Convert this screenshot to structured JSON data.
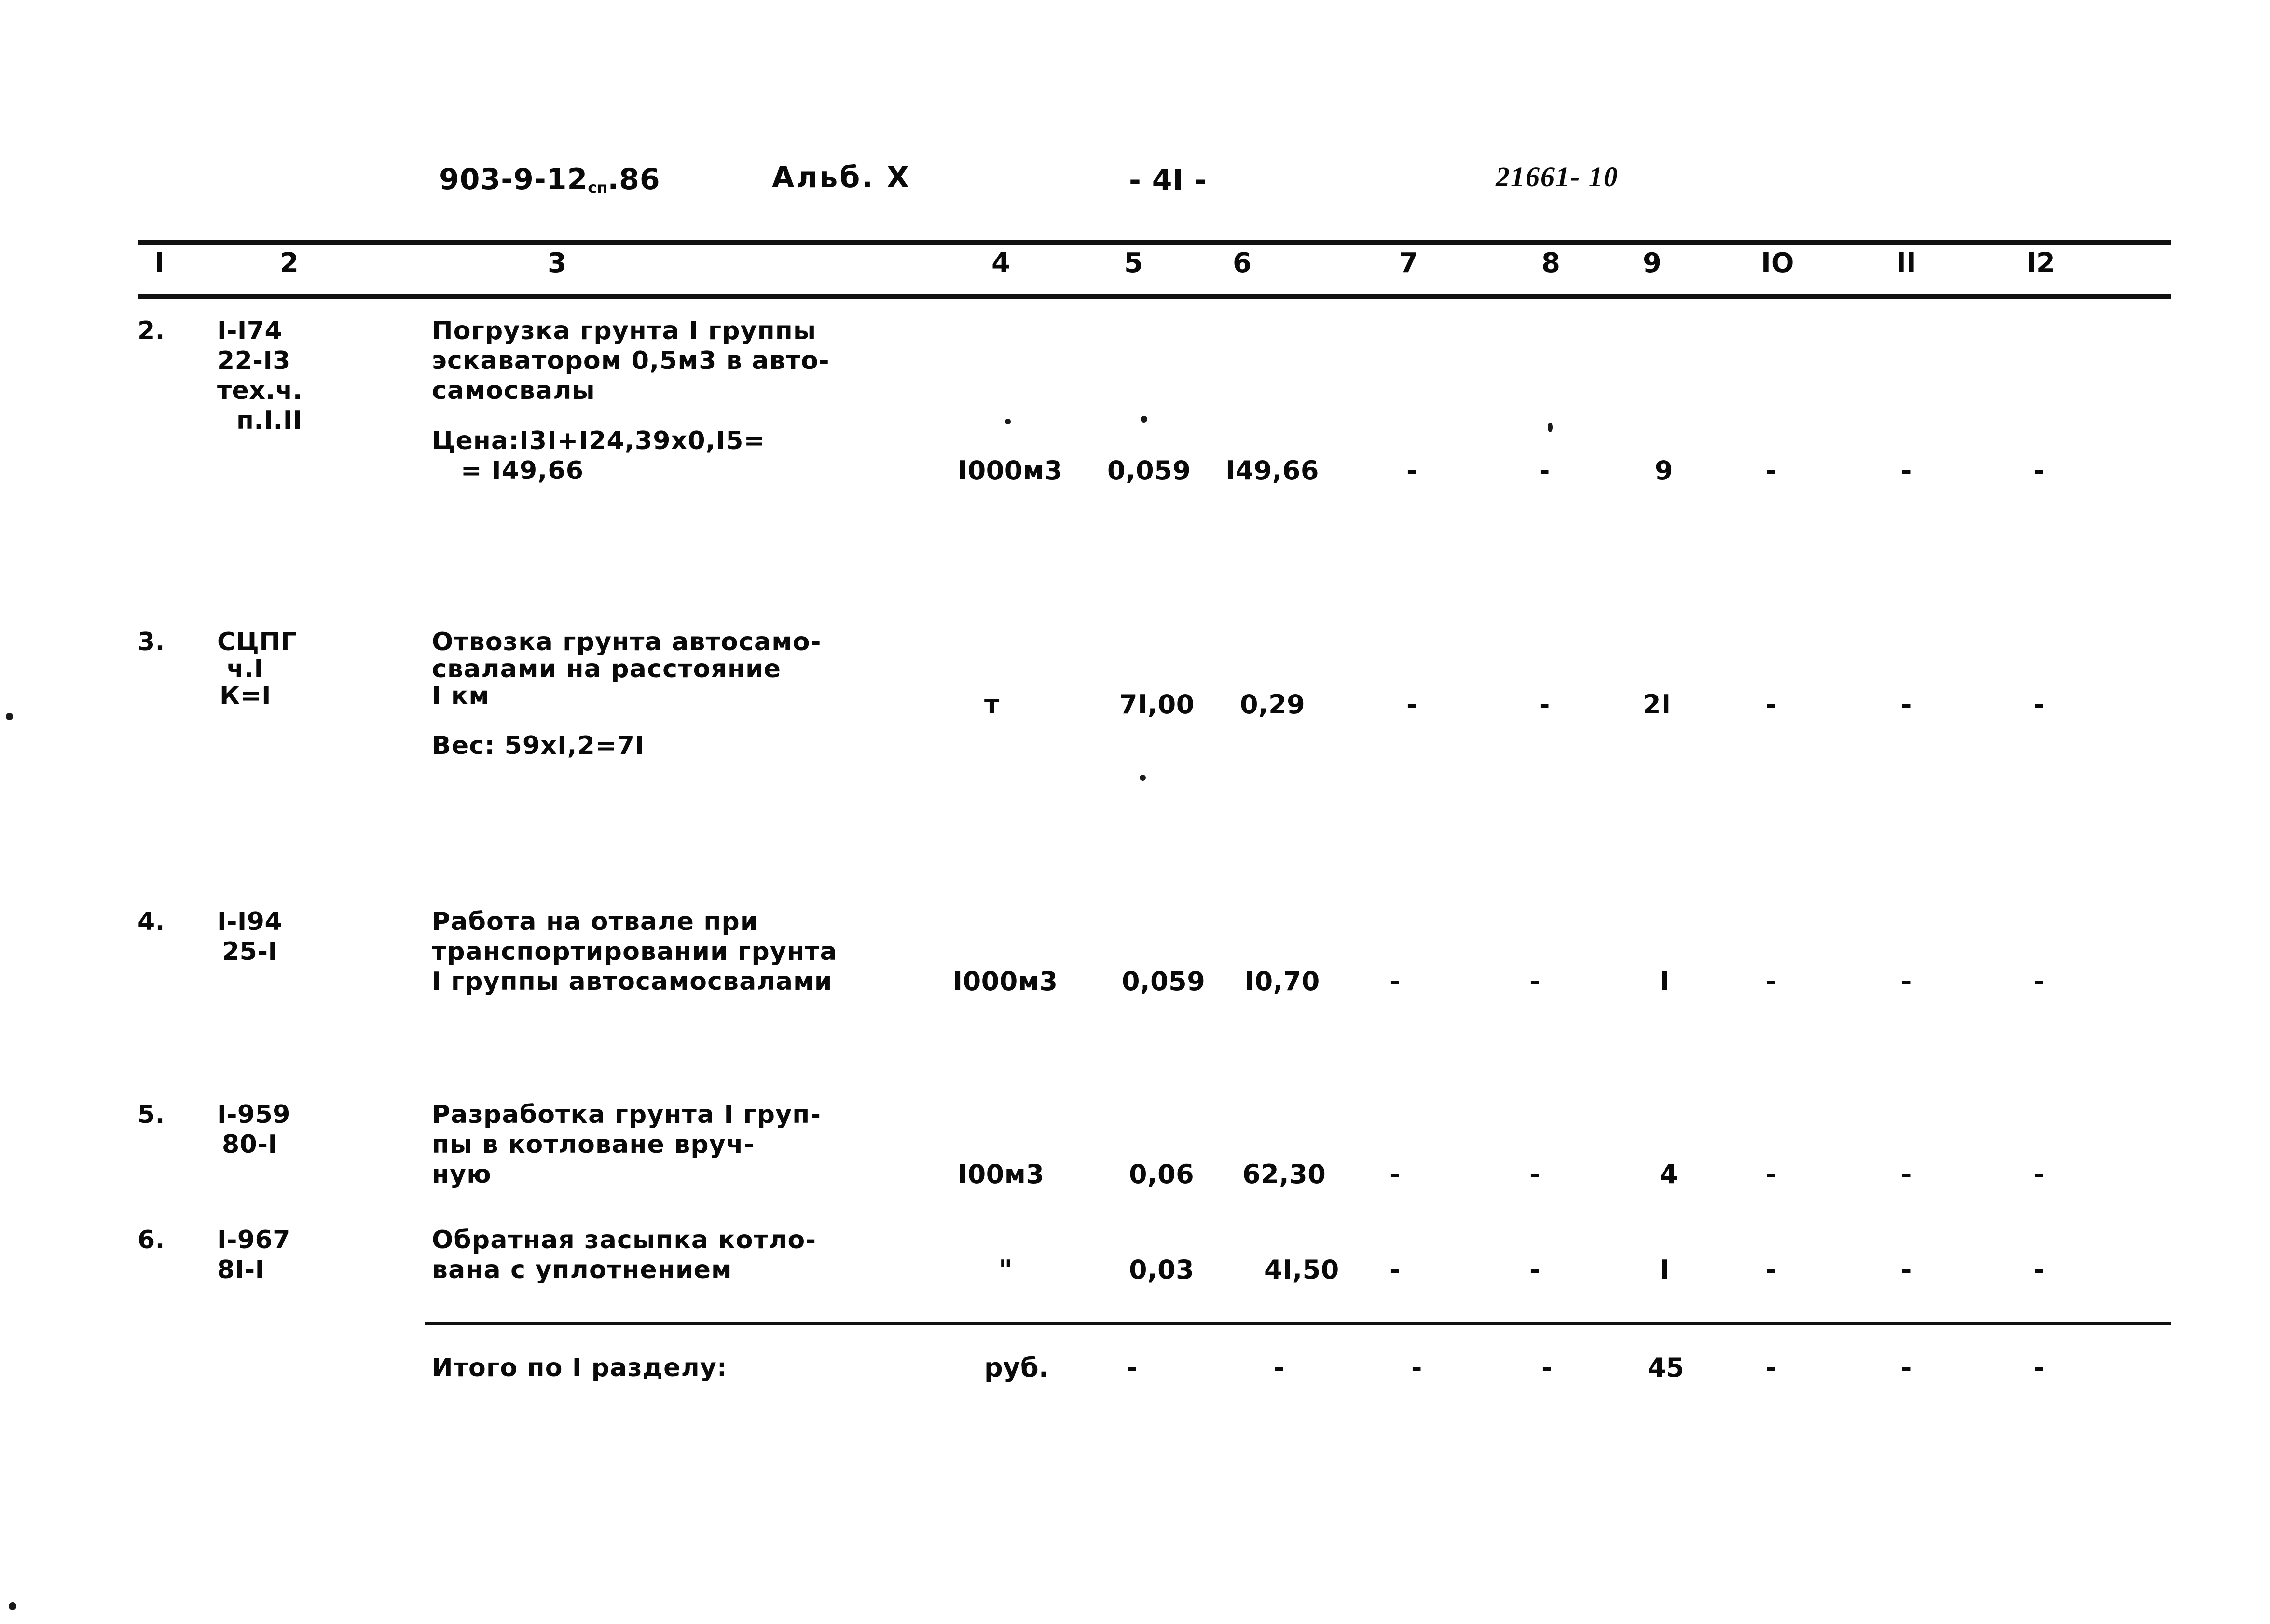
{
  "header": {
    "doc_code": "903-9-12",
    "doc_code_sub": "сп",
    "doc_code_year": ".86",
    "album": "Альб.  X",
    "page_number": "- 4I -",
    "stamp": "21661- 10"
  },
  "table": {
    "column_headers": [
      "I",
      "2",
      "3",
      "4",
      "5",
      "6",
      "7",
      "8",
      "9",
      "IO",
      "II",
      "I2"
    ],
    "rows": [
      {
        "no": "2.",
        "code_lines": [
          "I-I74",
          "22-I3",
          "тех.ч.",
          "п.I.II"
        ],
        "desc_lines": [
          "Погрузка грунта I группы",
          "эскаватором 0,5м3 в авто-",
          "самосвалы"
        ],
        "note_lines": [
          "Цена:I3I+I24,39х0,I5=",
          "= I49,66"
        ],
        "unit": "I000м3",
        "c5": "0,059",
        "c6": "I49,66",
        "c7": "-",
        "c8": "-",
        "c9": "9",
        "c10": "-",
        "c11": "-",
        "c12": "-"
      },
      {
        "no": "3.",
        "code_lines": [
          "СЦПГ",
          "ч.I",
          "К=I"
        ],
        "desc_lines": [
          "Отвозка грунта автосамо-",
          "свалами на расстояние",
          "I км"
        ],
        "note_lines": [
          "Вес: 59хI,2=7I"
        ],
        "unit": "т",
        "c5": "7I,00",
        "c6": "0,29",
        "c7": "-",
        "c8": "-",
        "c9": "2I",
        "c10": "-",
        "c11": "-",
        "c12": "-"
      },
      {
        "no": "4.",
        "code_lines": [
          "I-I94",
          "25-I"
        ],
        "desc_lines": [
          "Работа на отвале при",
          "транспортировании грунта",
          "I группы автосамосвалами"
        ],
        "note_lines": [],
        "unit": "I000м3",
        "c5": "0,059",
        "c6": "I0,70",
        "c7": "-",
        "c8": "-",
        "c9": "I",
        "c10": "-",
        "c11": "-",
        "c12": "-"
      },
      {
        "no": "5.",
        "code_lines": [
          "I-959",
          "80-I"
        ],
        "desc_lines": [
          "Разработка грунта I груп-",
          "пы в котловане вруч-",
          "ную"
        ],
        "note_lines": [],
        "unit": "I00м3",
        "c5": "0,06",
        "c6": "62,30",
        "c7": "-",
        "c8": "-",
        "c9": "4",
        "c10": "-",
        "c11": "-",
        "c12": "-"
      },
      {
        "no": "6.",
        "code_lines": [
          "I-967",
          "8I-I"
        ],
        "desc_lines": [
          "Обратная засыпка котло-",
          "вана с уплотнением"
        ],
        "note_lines": [],
        "unit": "\"",
        "c5": "0,03",
        "c6": "4I,50",
        "c7": "-",
        "c8": "-",
        "c9": "I",
        "c10": "-",
        "c11": "-",
        "c12": "-"
      }
    ],
    "total_row": {
      "label": "Итого по I разделу:",
      "unit": "руб.",
      "c5": "-",
      "c6": "-",
      "c7": "-",
      "c8": "-",
      "c9": "45",
      "c10": "-",
      "c11": "-",
      "c12": "-"
    }
  }
}
